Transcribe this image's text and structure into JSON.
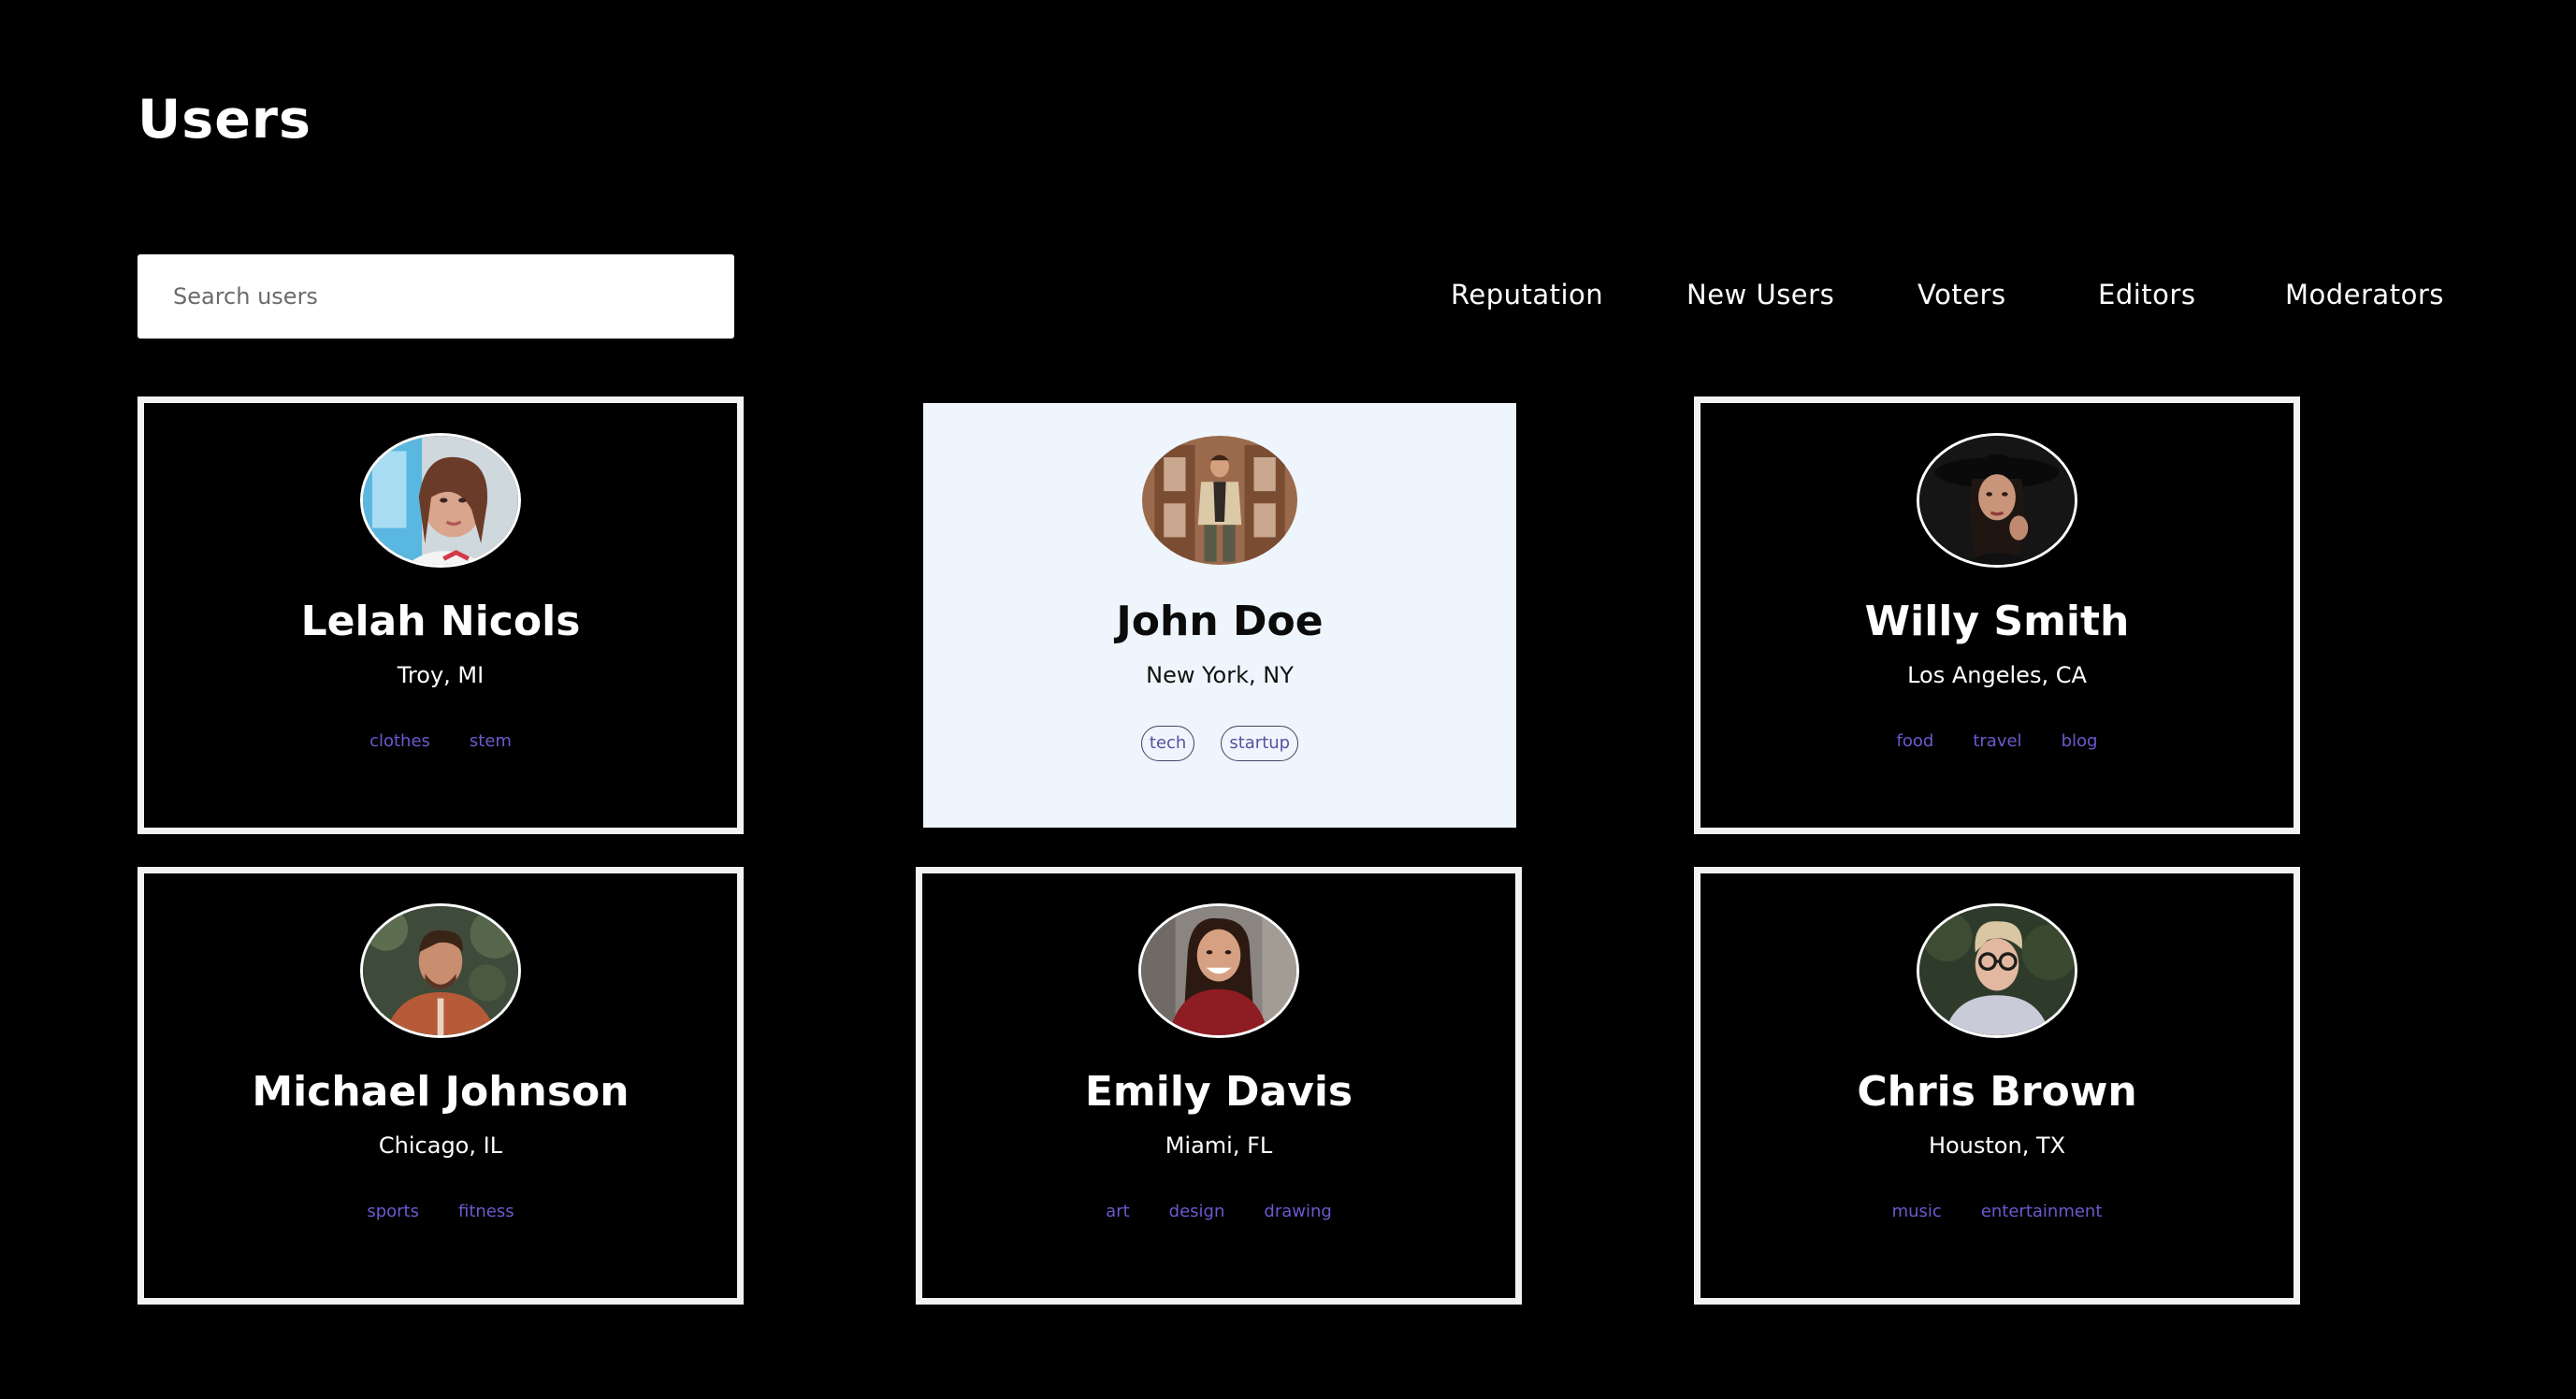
{
  "header": {
    "title": "Users"
  },
  "search": {
    "placeholder": "Search users",
    "value": ""
  },
  "filters": [
    {
      "label": "Reputation"
    },
    {
      "label": "New Users"
    },
    {
      "label": "Voters"
    },
    {
      "label": "Editors"
    },
    {
      "label": "Moderators"
    }
  ],
  "users": [
    {
      "name": "Lelah Nicols",
      "location": "Troy, MI",
      "tags": [
        "clothes",
        "stem"
      ],
      "selected": false
    },
    {
      "name": "John Doe",
      "location": "New York, NY",
      "tags": [
        "tech",
        "startup"
      ],
      "selected": true
    },
    {
      "name": "Willy Smith",
      "location": "Los Angeles, CA",
      "tags": [
        "food",
        "travel",
        "blog"
      ],
      "selected": false
    },
    {
      "name": "Michael Johnson",
      "location": "Chicago, IL",
      "tags": [
        "sports",
        "fitness"
      ],
      "selected": false
    },
    {
      "name": "Emily Davis",
      "location": "Miami, FL",
      "tags": [
        "art",
        "design",
        "drawing"
      ],
      "selected": false
    },
    {
      "name": "Chris Brown",
      "location": "Houston, TX",
      "tags": [
        "music",
        "entertainment"
      ],
      "selected": false
    }
  ],
  "colors": {
    "background": "#000000",
    "card_border": "#f2f2f2",
    "selected_card_background": "#eff5fc",
    "tag_text": "#6a5acd"
  }
}
